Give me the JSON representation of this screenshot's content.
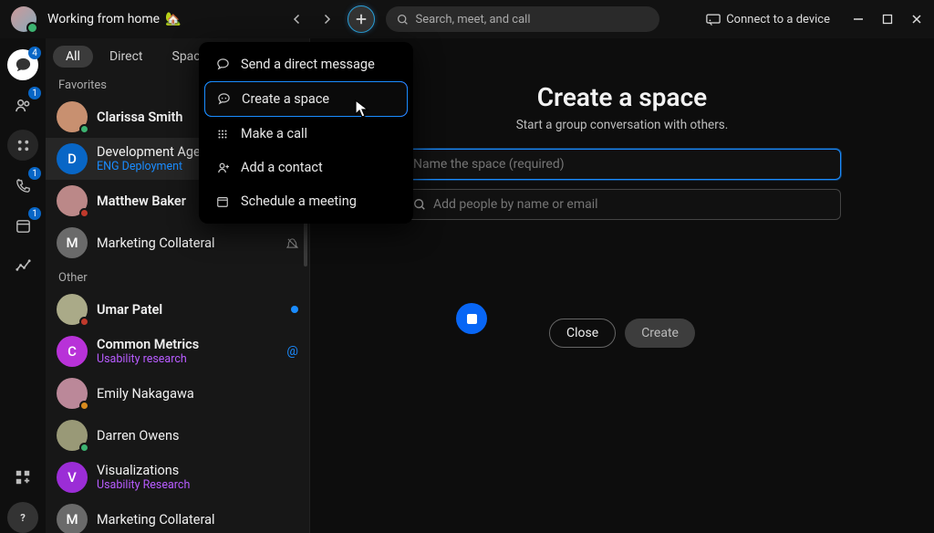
{
  "titlebar": {
    "status_text": "Working from home",
    "status_emoji": "🏡",
    "search_placeholder": "Search, meet, and call",
    "connect_label": "Connect to a device"
  },
  "rail": {
    "badges": {
      "messaging": "4",
      "people": "1",
      "calls": "1",
      "calendar": "1"
    }
  },
  "tabs": {
    "all": "All",
    "direct": "Direct",
    "spaces": "Spaces"
  },
  "sections": {
    "favorites": "Favorites",
    "other": "Other"
  },
  "favorites": [
    {
      "title": "Clarissa Smith",
      "bold": true,
      "avatar_bg": "#c89070",
      "presence": "#3cb371"
    },
    {
      "title": "Development Agency",
      "sub": "ENG Deployment",
      "sub_color": "#1a8cff",
      "avatar_letter": "D",
      "avatar_bg": "#0866c6",
      "selected": true
    },
    {
      "title": "Matthew Baker",
      "bold": true,
      "avatar_bg": "#b88",
      "presence": "#c0392b"
    },
    {
      "title": "Marketing Collateral",
      "avatar_letter": "M",
      "avatar_bg": "#6a6a6a",
      "trail": "mute"
    }
  ],
  "other": [
    {
      "title": "Umar Patel",
      "bold": true,
      "avatar_bg": "#aa8",
      "presence": "#c0392b",
      "trail": "dot"
    },
    {
      "title": "Common Metrics",
      "bold": true,
      "sub": "Usability research",
      "sub_color": "#b85cff",
      "avatar_letter": "C",
      "avatar_bg": "#b832d8",
      "trail": "at"
    },
    {
      "title": "Emily Nakagawa",
      "avatar_bg": "#b89",
      "presence": "#d88a1e"
    },
    {
      "title": "Darren Owens",
      "avatar_bg": "#997",
      "presence": "#3cb371"
    },
    {
      "title": "Visualizations",
      "sub": "Usability Research",
      "sub_color": "#b85cff",
      "avatar_letter": "V",
      "avatar_bg": "#9b2dd6"
    },
    {
      "title": "Marketing Collateral",
      "avatar_letter": "M",
      "avatar_bg": "#6a6a6a"
    }
  ],
  "dropdown": {
    "send_dm": "Send a direct message",
    "create_space": "Create a space",
    "make_call": "Make a call",
    "add_contact": "Add a contact",
    "schedule_meeting": "Schedule a meeting"
  },
  "panel": {
    "title": "Create a space",
    "subtitle": "Start a group conversation with others.",
    "name_placeholder": "Name the space (required)",
    "people_placeholder": "Add people by name or email",
    "close": "Close",
    "create": "Create"
  }
}
